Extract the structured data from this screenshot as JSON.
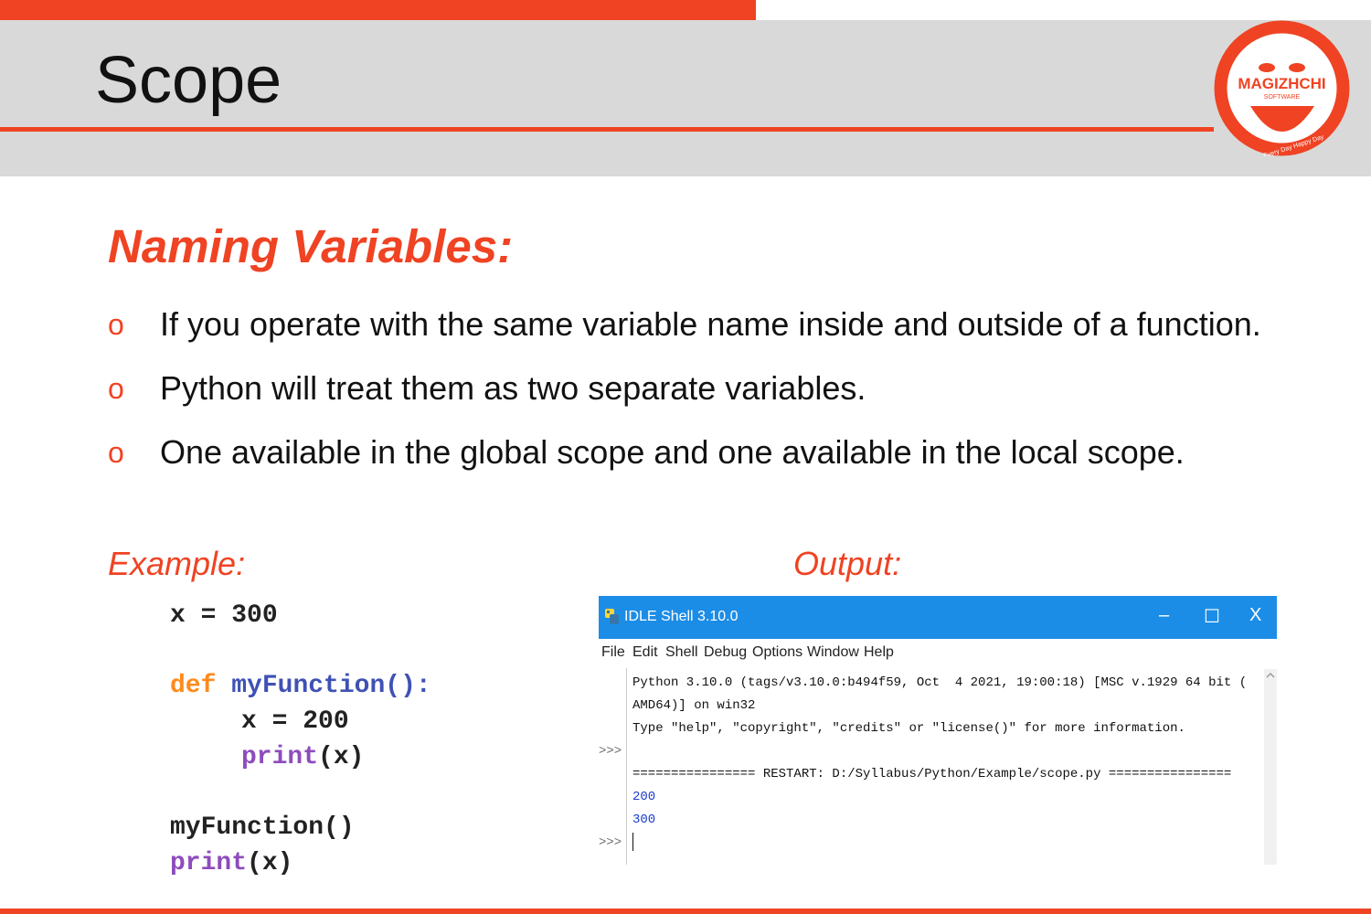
{
  "slide": {
    "title": "Scope",
    "section_title": "Naming Variables:",
    "bullets": [
      "If you operate with the same variable name inside and outside of a function.",
      "Python will treat them as two separate variables.",
      "One available in the global scope and one available in the local scope."
    ],
    "bullet_marker": "o",
    "example_label": "Example:",
    "output_label": "Output:"
  },
  "logo": {
    "name": "MAGIZHCHI",
    "subtitle": "SOFTWARE",
    "tagline": "Every Day Happy Day"
  },
  "code": {
    "line1": "x = 300",
    "def_kw": "def",
    "func_name": "myFunction():",
    "line3": "x = 200",
    "print_kw": "print",
    "print_arg": "(x)",
    "call_line": "myFunction()",
    "print_kw2": "print",
    "print_arg2": "(x)"
  },
  "idle": {
    "window_title": "IDLE Shell 3.10.0",
    "controls": {
      "minimize": "–",
      "maximize": "☐",
      "close": "X"
    },
    "menu": [
      "File",
      "Edit",
      "Shell",
      "Debug",
      "Options",
      "Window",
      "Help"
    ],
    "lines": {
      "l1": "Python 3.10.0 (tags/v3.10.0:b494f59, Oct  4 2021, 19:00:18) [MSC v.1929 64 bit (",
      "l2": "AMD64)] on win32",
      "l3": "Type \"help\", \"copyright\", \"credits\" or \"license()\" for more information.",
      "l4": "================ RESTART: D:/Syllabus/Python/Example/scope.py ================",
      "out1": "200",
      "out2": "300"
    },
    "prompt": ">>>"
  },
  "colors": {
    "accent": "#ef4323",
    "header_bg": "#d9d9d9",
    "titlebar": "#1c8de6"
  }
}
